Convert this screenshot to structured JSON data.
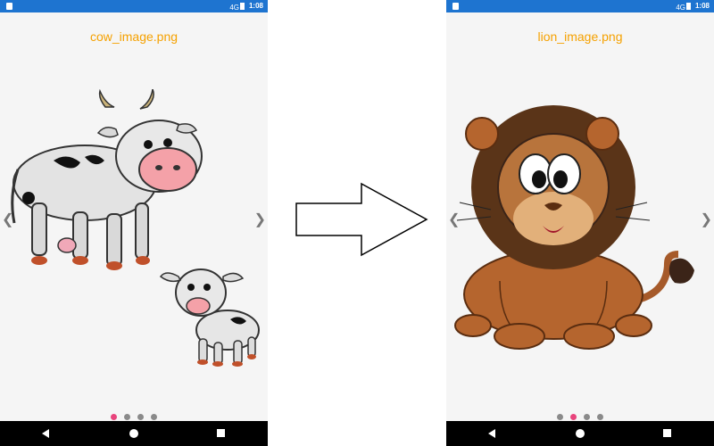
{
  "left_screen": {
    "status": {
      "signal": "4G",
      "time": "1:08"
    },
    "title": "cow_image.png",
    "prev_chevron": "❮",
    "next_chevron": "❯",
    "active_index": 0
  },
  "arrow": {
    "icon": "right-arrow"
  },
  "right_screen": {
    "status": {
      "signal": "4G",
      "time": "1:08"
    },
    "title": "lion_image.png",
    "prev_chevron": "❮",
    "next_chevron": "❯",
    "active_index": 1
  },
  "colors": {
    "status_bar": "#1e74d0",
    "title": "#f5a100",
    "active_dot": "#e8447c",
    "dot": "#8a8a8a"
  }
}
